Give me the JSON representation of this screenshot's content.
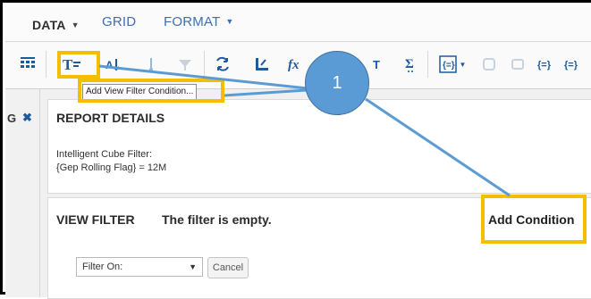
{
  "tabs": {
    "data_label": "DATA",
    "grid_label": "GRID",
    "format_label": "FORMAT"
  },
  "toolbar": {
    "icons": [
      "grid-layout-icon",
      "view-filter-icon",
      "sort-icon",
      "drill-icon",
      "filter-icon",
      "pivot-icon",
      "insert-function-icon",
      "fx-icon",
      "sum-icon",
      "subtotal-icon",
      "subtotal-dropdown-icon",
      "metric-icon",
      "view-icon",
      "percent-icon"
    ]
  },
  "tooltip": {
    "text": "Add View Filter Condition..."
  },
  "report_details": {
    "title": "REPORT DETAILS",
    "line1": "Intelligent Cube Filter:",
    "line2": "{Gep Rolling Flag} = 12M"
  },
  "view_filter": {
    "title": "VIEW FILTER",
    "status": "The filter is empty.",
    "add_condition_label": "Add Condition",
    "filter_on_value": "Filter On:",
    "cancel_label": "Cancel"
  },
  "annotation": {
    "badge_number": "1",
    "highlight_color": "#f5bd00",
    "badge_color": "#5b9bd5"
  },
  "colors": {
    "accent_blue": "#3d6fb0",
    "icon_blue": "#1e5a9c"
  }
}
